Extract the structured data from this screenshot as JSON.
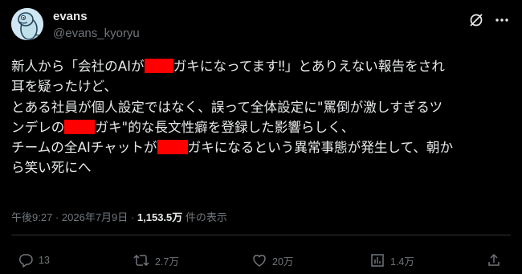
{
  "author": {
    "display_name": "evans",
    "handle": "@evans_kyoryu",
    "avatar_icon": "dinosaur-avatar-icon"
  },
  "top_actions": [
    {
      "name": "grok-icon"
    },
    {
      "name": "more-icon",
      "glyph": "···"
    }
  ],
  "post": {
    "lines": [
      {
        "segments": [
          {
            "t": "新人から「会社のAIが"
          },
          {
            "r": true
          },
          {
            "t": "ガキになってます‼」とありえない報告をされ"
          }
        ]
      },
      {
        "segments": [
          {
            "t": "耳を疑ったけど、"
          }
        ]
      },
      {
        "segments": [
          {
            "t": "とある社員が個人設定ではなく、誤って全体設定に\"罵倒が激しすぎるツ"
          }
        ]
      },
      {
        "segments": [
          {
            "t": "ンデレの"
          },
          {
            "r": true
          },
          {
            "t": "ガキ\"的な長文性癖を登録した影響らしく、"
          }
        ]
      },
      {
        "segments": [
          {
            "t": "チームの全AIチャットが"
          },
          {
            "r": true
          },
          {
            "t": "ガキになるという異常事態が発生して、朝か"
          }
        ]
      },
      {
        "segments": [
          {
            "t": "ら笑い死にへ"
          }
        ]
      }
    ],
    "redaction_color": "#ff0000"
  },
  "meta": {
    "time": "午後9:27",
    "separator": "·",
    "date": "2026年7月9日",
    "views_count": "1,153.5万",
    "views_label": "件の表示"
  },
  "actions": {
    "reply_count": "13",
    "repost_count": "2.7万",
    "like_count": "20万",
    "bookmark_count": "1.4万"
  },
  "colors": {
    "background": "#000000",
    "text_primary": "#e7e9ea",
    "text_secondary": "#71767b",
    "divider": "#2f3336"
  }
}
